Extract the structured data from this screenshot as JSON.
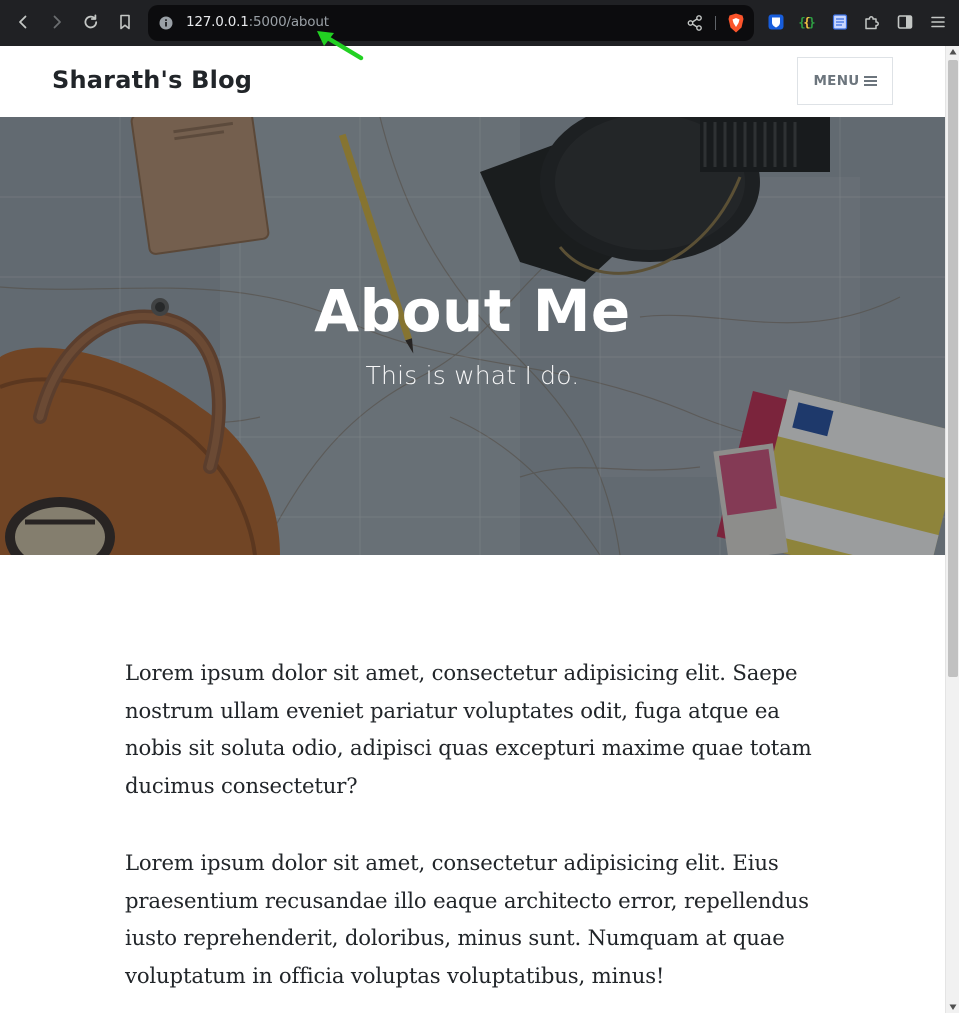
{
  "browser": {
    "url_host": "127.0.0.1",
    "url_path": ":5000/about",
    "icons": {
      "back": "back-arrow-icon",
      "forward": "forward-arrow-icon",
      "reload": "reload-icon",
      "bookmark": "bookmark-icon",
      "site_info": "info-icon",
      "share": "share-icon",
      "brave": "brave-shields-icon",
      "bitwarden": "bitwarden-icon",
      "json_ext": "json-viewer-icon",
      "reader": "reader-icon",
      "extensions": "puzzle-icon",
      "sidebar": "sidebar-icon",
      "menu": "hamburger-menu-icon"
    }
  },
  "navbar": {
    "brand": "Sharath's Blog",
    "menu_label": "MENU"
  },
  "hero": {
    "title": "About Me",
    "subtitle": "This is what I do."
  },
  "content": {
    "paragraphs": [
      "Lorem ipsum dolor sit amet, consectetur adipisicing elit. Saepe nostrum ullam eveniet pariatur voluptates odit, fuga atque ea nobis sit soluta odio, adipisci quas excepturi maxime quae totam ducimus consectetur?",
      "Lorem ipsum dolor sit amet, consectetur adipisicing elit. Eius praesentium recusandae illo eaque architecto error, repellendus iusto reprehenderit, doloribus, minus sunt. Numquam at quae voluptatum in officia voluptas voluptatibus, minus!"
    ]
  },
  "colors": {
    "chrome_bg": "#202124",
    "omnibox_bg": "#0c0c0e",
    "annotation_arrow": "#22d122",
    "text": "#212529",
    "muted": "#6c757d"
  }
}
